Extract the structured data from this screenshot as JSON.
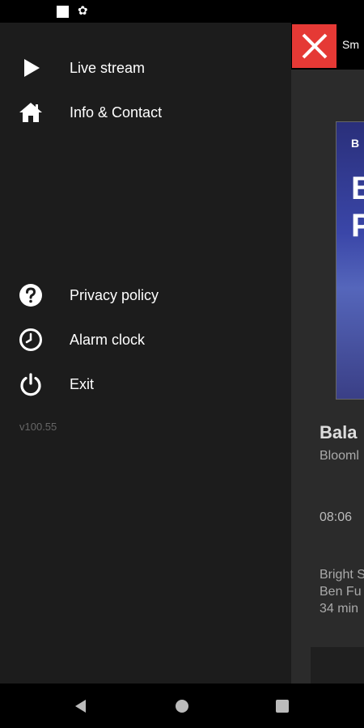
{
  "status_bar": {
    "icons": [
      "square-icon",
      "gear-icon"
    ]
  },
  "drawer": {
    "items_top": [
      {
        "label": "Live stream",
        "icon": "play-icon"
      },
      {
        "label": "Info & Contact",
        "icon": "home-icon"
      }
    ],
    "items_bottom": [
      {
        "label": "Privacy policy",
        "icon": "question-circle-icon"
      },
      {
        "label": "Alarm clock",
        "icon": "clock-icon"
      },
      {
        "label": "Exit",
        "icon": "power-icon"
      }
    ],
    "version": "v100.55"
  },
  "content": {
    "topbar_title": "Sm",
    "close_icon": "close-icon",
    "close_color": "#e53935",
    "thumbnail_lines": [
      "B",
      "B",
      "P"
    ],
    "card": {
      "title": "Bala",
      "subtitle": "Blooml",
      "time": "08:06",
      "description": [
        "Bright S",
        "Ben Fu",
        "34 min"
      ]
    }
  },
  "nav_bar": {
    "buttons": [
      "back-icon",
      "home-circle-icon",
      "recents-icon"
    ]
  }
}
